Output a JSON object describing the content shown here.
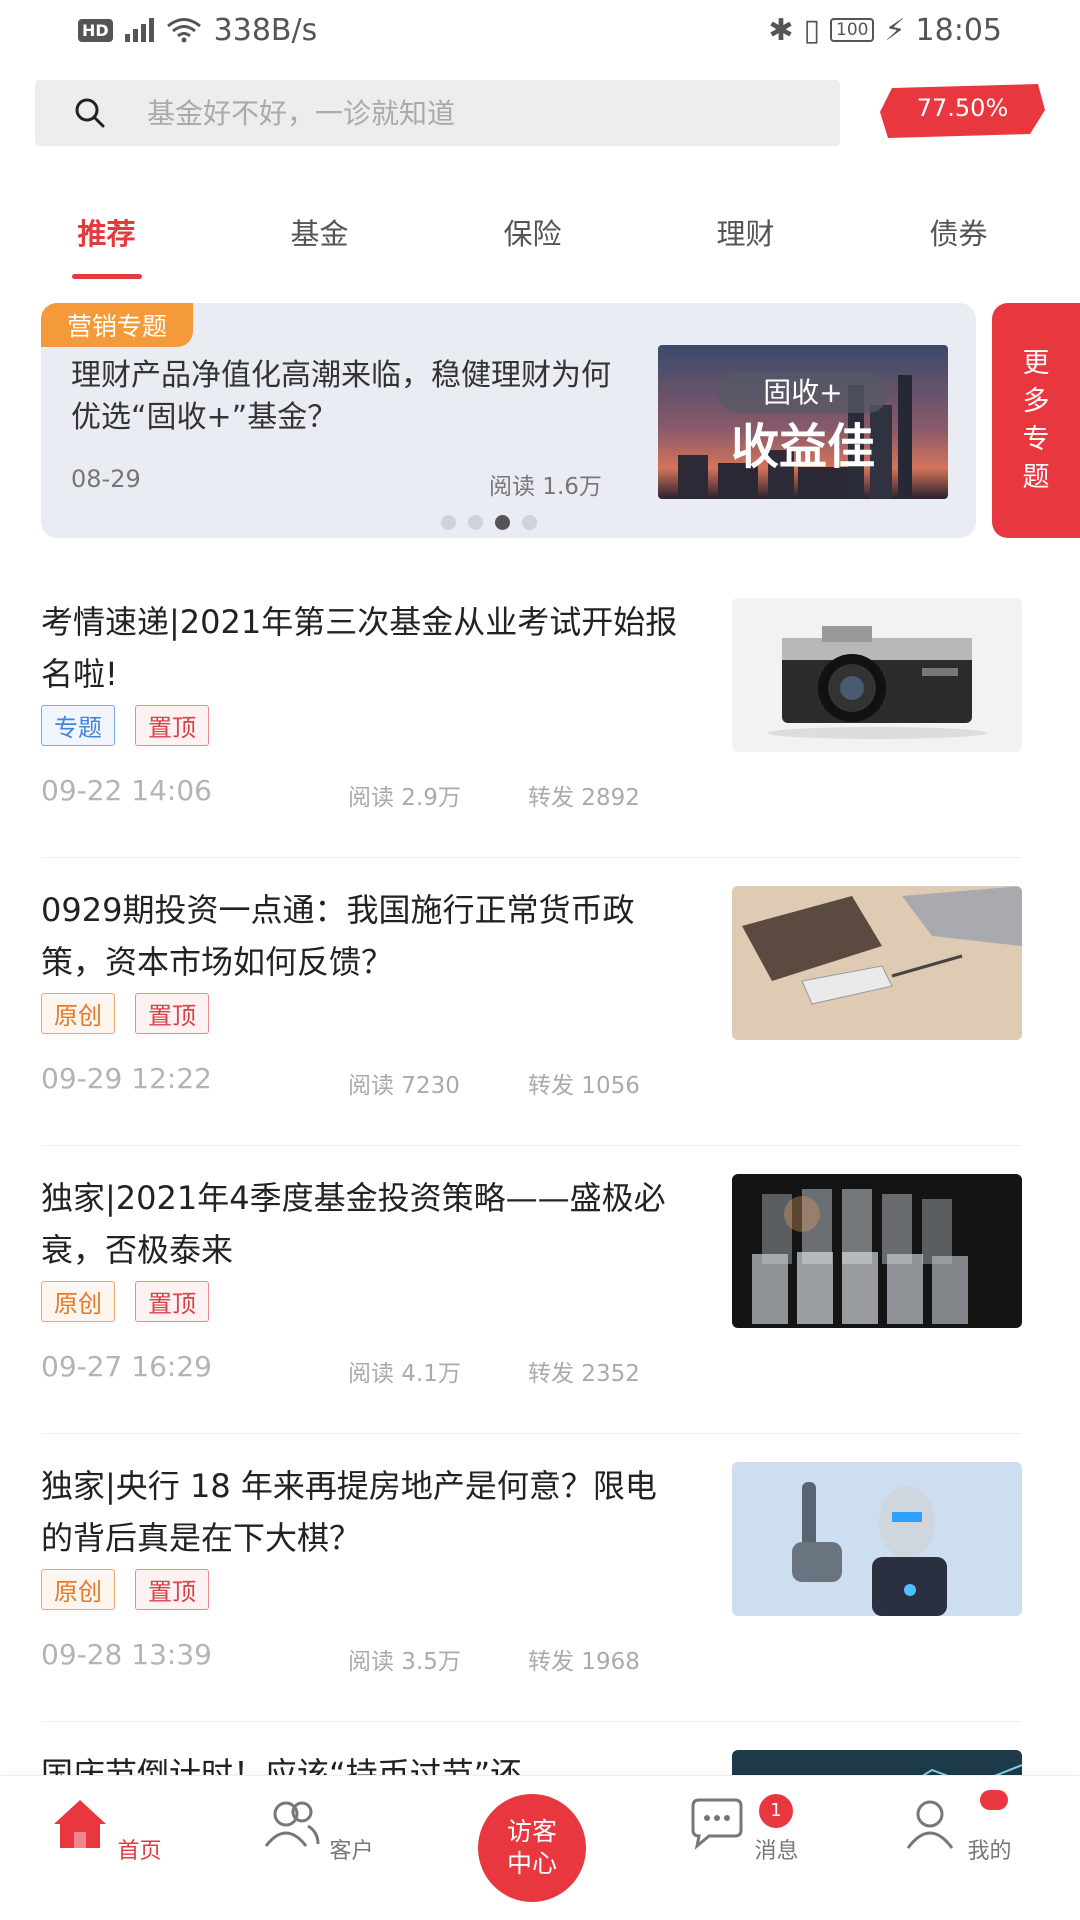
{
  "status_bar": {
    "hd": "HD",
    "network": "4G",
    "speed": "338B/s",
    "battery": "100",
    "time": "18:05"
  },
  "search": {
    "placeholder": "基金好不好，一诊就知道",
    "rate_badge": "77.50%"
  },
  "tabs": [
    {
      "label": "推荐",
      "active": true
    },
    {
      "label": "基金",
      "active": false
    },
    {
      "label": "保险",
      "active": false
    },
    {
      "label": "理财",
      "active": false
    },
    {
      "label": "债券",
      "active": false
    }
  ],
  "banner": {
    "tag": "营销专题",
    "title": "理财产品净值化高潮来临，稳健理财为何优选“固收+”基金？",
    "date": "08-29",
    "read_label": "阅读 1.6万",
    "image_line1": "固收+",
    "image_line2": "收益佳",
    "more_topics": [
      "更",
      "多",
      "专",
      "题"
    ]
  },
  "articles": [
    {
      "title": "考情速递|2021年第三次基金从业考试开始报名啦!",
      "tags": [
        {
          "label": "专题",
          "kind": "topic"
        },
        {
          "label": "置顶",
          "kind": "pin"
        }
      ],
      "time": "09-22 14:06",
      "reads": "阅读 2.9万",
      "shares": "转发 2892",
      "image": "camera"
    },
    {
      "title": "0929期投资一点通：我国施行正常货币政策，资本市场如何反馈？",
      "tags": [
        {
          "label": "原创",
          "kind": "orig"
        },
        {
          "label": "置顶",
          "kind": "pin"
        }
      ],
      "time": "09-29 12:22",
      "reads": "阅读 7230",
      "shares": "转发 1056",
      "image": "desk"
    },
    {
      "title": "独家|2021年4季度基金投资策略——盛极必衰，否极泰来",
      "tags": [
        {
          "label": "原创",
          "kind": "orig"
        },
        {
          "label": "置顶",
          "kind": "pin"
        }
      ],
      "time": "09-27 16:29",
      "reads": "阅读 4.1万",
      "shares": "转发 2352",
      "image": "glasses"
    },
    {
      "title": "独家|央行 18 年来再提房地产是何意？限电的背后真是在下大棋？",
      "tags": [
        {
          "label": "原创",
          "kind": "orig"
        },
        {
          "label": "置顶",
          "kind": "pin"
        }
      ],
      "time": "09-28 13:39",
      "reads": "阅读 3.5万",
      "shares": "转发 1968",
      "image": "robot"
    },
    {
      "title": "国庆节倒计时！应该“持币过节”还",
      "tags": [],
      "time": "",
      "reads": "",
      "shares": "",
      "image": "chart"
    }
  ],
  "bottom_nav": {
    "home": "首页",
    "customers": "客户",
    "visitor_center": "访客中心",
    "messages": "消息",
    "messages_badge": "1",
    "mine": "我的"
  },
  "colors": {
    "accent": "#e23b3b",
    "banner_tag": "#f59a3a",
    "banner_bg": "#e9edf3"
  }
}
